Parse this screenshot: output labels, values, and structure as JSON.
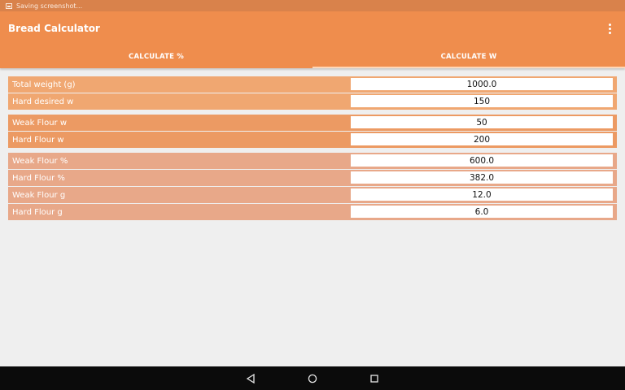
{
  "status_bar": {
    "notification": "Saving screenshot..."
  },
  "app_bar": {
    "title": "Bread Calculator"
  },
  "tabs": [
    {
      "label": "CALCULATE %"
    },
    {
      "label": "CALCULATE W"
    }
  ],
  "inputs": [
    {
      "label": "Total weight (g)",
      "value": "1000.0"
    },
    {
      "label": "Hard desired w",
      "value": "150"
    }
  ],
  "flour_inputs": [
    {
      "label": "Weak Flour w",
      "value": "50"
    },
    {
      "label": "Hard Flour w",
      "value": "200"
    }
  ],
  "results": [
    {
      "label": "Weak Flour %",
      "value": "600.0"
    },
    {
      "label": "Hard Flour %",
      "value": "382.0"
    },
    {
      "label": "Weak Flour g",
      "value": "12.0"
    },
    {
      "label": "Hard Flour g",
      "value": "6.0"
    }
  ],
  "colors": {
    "primary": "#ef8d4d",
    "status_bar": "#d9824b",
    "row_group_1": "#f0a771",
    "row_group_2": "#ec9a63",
    "row_group_3": "#e8a889"
  },
  "icons": {
    "status": "screenshot-icon",
    "overflow": "more-vert-icon",
    "nav": [
      "back-icon",
      "home-icon",
      "recents-icon"
    ]
  }
}
